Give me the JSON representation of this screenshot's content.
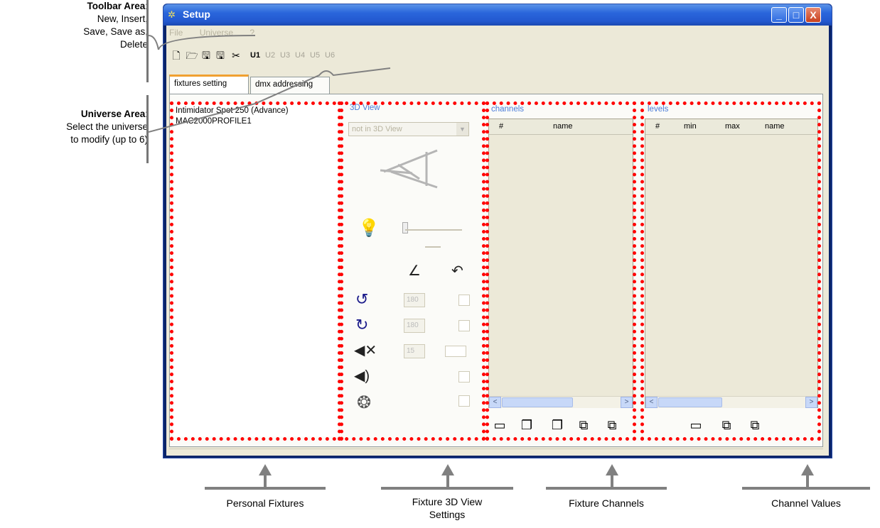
{
  "annotations": {
    "toolbar_area": {
      "title": "Toolbar Area",
      "colon": ":",
      "lines": [
        "New, Insert,",
        "Save, Save as,",
        "Delete"
      ]
    },
    "universe_area": {
      "title": "Universe Area",
      "colon": ":",
      "lines": [
        "Select the universe",
        "to modify (up to 6)"
      ]
    },
    "callouts": {
      "personal_fixtures": "Personal Fixtures",
      "fixture_3d_view_settings_line1": "Fixture 3D View",
      "fixture_3d_view_settings_line2": "Settings",
      "fixture_channels": "Fixture Channels",
      "channel_values": "Channel Values"
    }
  },
  "window": {
    "title": "Setup",
    "buttons": {
      "minimize": "_",
      "maximize": "□",
      "close": "X"
    }
  },
  "menu": {
    "items": [
      "File",
      "Universe",
      "?"
    ]
  },
  "toolbar": {
    "icons": [
      "new-icon",
      "insert-icon",
      "save-icon",
      "save-as-icon",
      "delete-icon"
    ],
    "glyphs": [
      "🗋",
      "🗁",
      "🖫",
      "🖫",
      "✂"
    ],
    "universes": [
      "U1",
      "U2",
      "U3",
      "U4",
      "U5",
      "U6"
    ],
    "active_universe": "U1"
  },
  "tabs": [
    "fixtures setting",
    "dmx addressing"
  ],
  "fixtures": {
    "items": [
      "Intimidator Spot 250 (Advance)",
      "MAC2000PROFILE1"
    ]
  },
  "view3d": {
    "label": "3D View",
    "combo_value": "not in 3D View",
    "fields": {
      "pan": "180",
      "tilt": "180",
      "beam": "15"
    }
  },
  "channels": {
    "label": "channels",
    "columns": [
      "#",
      "name"
    ]
  },
  "levels": {
    "label": "levels",
    "columns": [
      "#",
      "min",
      "max",
      "name"
    ]
  },
  "colors": {
    "highlight": "#ff0000",
    "group_label": "#4a7bd8",
    "window_blue": "#2a66dc"
  }
}
